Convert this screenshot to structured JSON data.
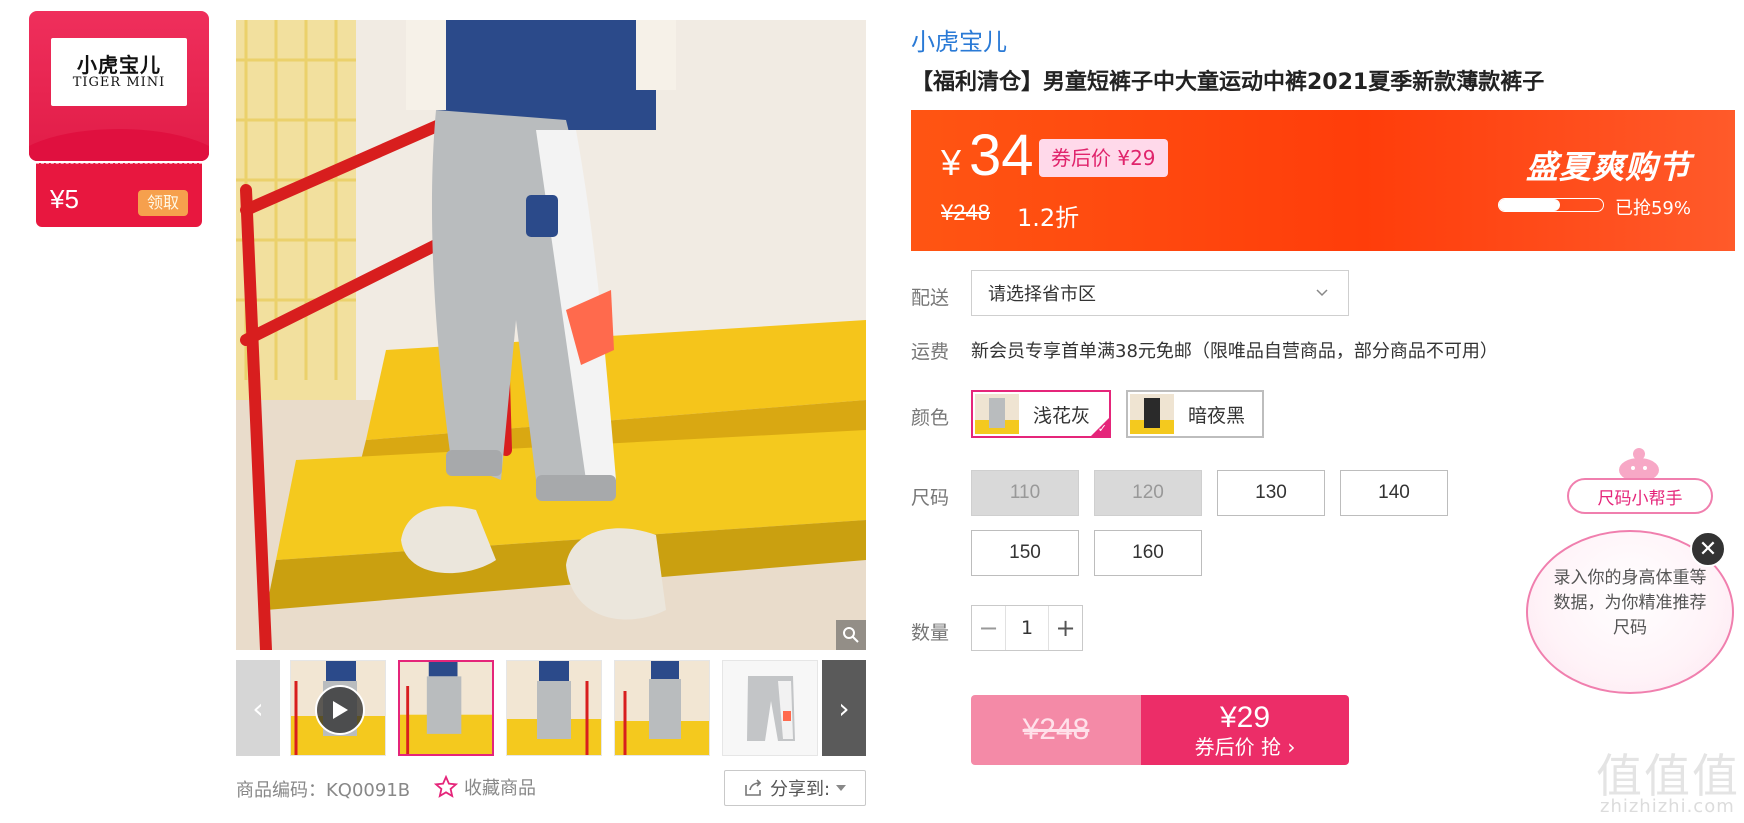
{
  "coupon": {
    "logo_cn": "小虎宝儿",
    "logo_en": "TIGER MINI",
    "amount": "¥5",
    "get_label": "领取"
  },
  "gallery": {
    "sku_label": "商品编码：KQ0091B",
    "favorite_label": "收藏商品",
    "share_label": "分享到:"
  },
  "product": {
    "brand": "小虎宝儿",
    "title": "【福利清仓】男童短裤子中大童运动中裤2021夏季新款薄款裤子"
  },
  "price": {
    "currency": "¥",
    "current": "34",
    "after_coupon": "券后价 ¥29",
    "original": "¥248",
    "discount": "1.2折",
    "promo_title": "盛夏爽购节",
    "sold_text": "已抢59%",
    "sold_fraction": 0.59
  },
  "delivery": {
    "label": "配送",
    "placeholder": "请选择省市区"
  },
  "shipping": {
    "label": "运费",
    "text": "新会员专享首单满38元免邮（限唯品自营商品，部分商品不可用）"
  },
  "colors": {
    "label": "颜色",
    "options": [
      {
        "name": "浅花灰",
        "selected": true
      },
      {
        "name": "暗夜黑",
        "selected": false
      }
    ]
  },
  "sizes": {
    "label": "尺码",
    "options": [
      {
        "value": "110",
        "available": false
      },
      {
        "value": "120",
        "available": false
      },
      {
        "value": "130",
        "available": true
      },
      {
        "value": "140",
        "available": true
      },
      {
        "value": "150",
        "available": true
      },
      {
        "value": "160",
        "available": true
      }
    ]
  },
  "quantity": {
    "label": "数量",
    "value": "1",
    "minus": "−",
    "plus": "+"
  },
  "buy": {
    "original_price": "¥248",
    "price": "¥29",
    "action": "券后价 抢 ›"
  },
  "size_helper": {
    "title": "尺码小帮手",
    "text": "录入你的身高体重等数据，为你精准推荐尺码",
    "close": "✕"
  },
  "watermark": {
    "glyphs": "值值值",
    "domain": "zhizhizhi.com"
  },
  "colors_theme": {
    "accent_pink": "#e5257a",
    "price_orange": "#ff4d12",
    "brand_blue": "#2a7ad6"
  }
}
